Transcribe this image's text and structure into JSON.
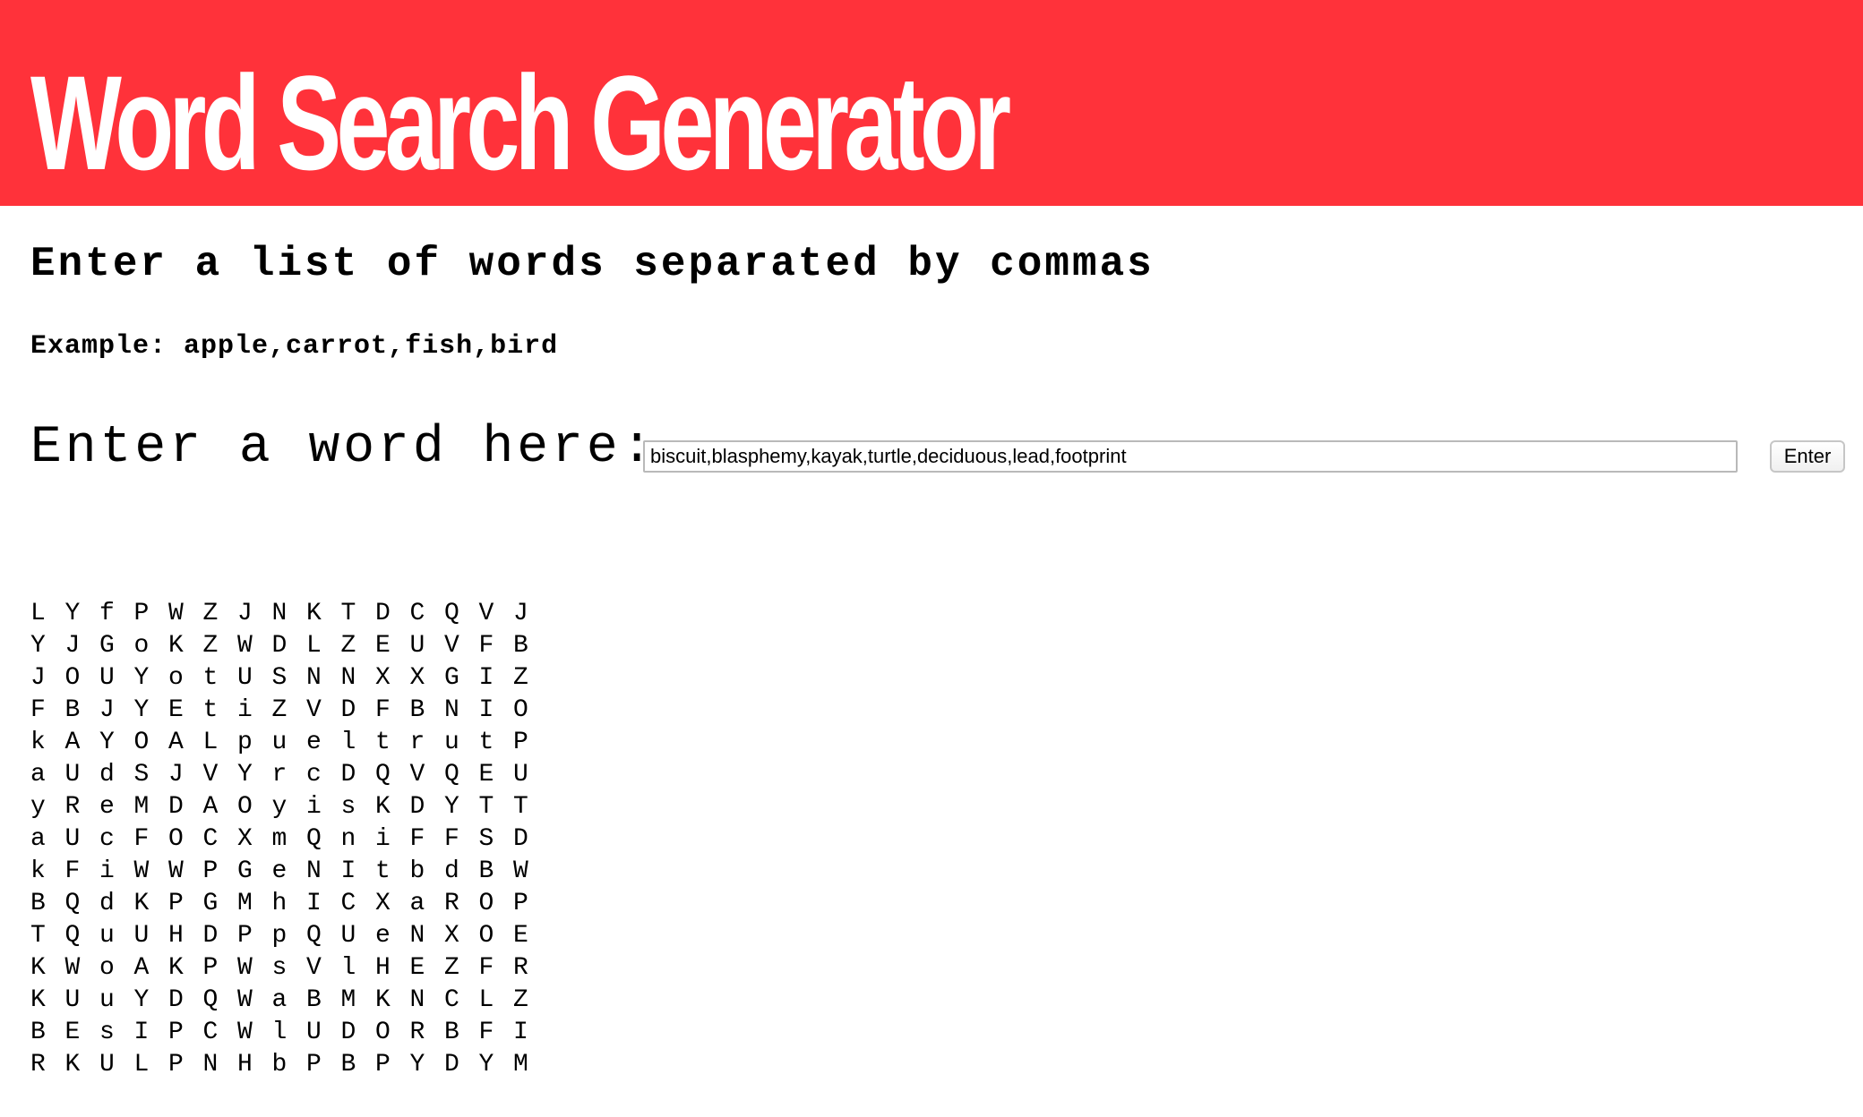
{
  "header": {
    "title": "Word Search Generator",
    "background_color": "#ff323a"
  },
  "instructions": {
    "heading": "Enter a list of words separated by commas",
    "example": "Example: apple,carrot,fish,bird"
  },
  "form": {
    "label": "Enter a word here:",
    "input_value": "biscuit,blasphemy,kayak,turtle,deciduous,lead,footprint",
    "button_label": "Enter"
  },
  "grid": [
    [
      "L",
      "Y",
      "f",
      "P",
      "W",
      "Z",
      "J",
      "N",
      "K",
      "T",
      "D",
      "C",
      "Q",
      "V",
      "J"
    ],
    [
      "Y",
      "J",
      "G",
      "o",
      "K",
      "Z",
      "W",
      "D",
      "L",
      "Z",
      "E",
      "U",
      "V",
      "F",
      "B"
    ],
    [
      "J",
      "O",
      "U",
      "Y",
      "o",
      "t",
      "U",
      "S",
      "N",
      "N",
      "X",
      "X",
      "G",
      "I",
      "Z"
    ],
    [
      "F",
      "B",
      "J",
      "Y",
      "E",
      "t",
      "i",
      "Z",
      "V",
      "D",
      "F",
      "B",
      "N",
      "I",
      "O"
    ],
    [
      "k",
      "A",
      "Y",
      "O",
      "A",
      "L",
      "p",
      "u",
      "e",
      "l",
      "t",
      "r",
      "u",
      "t",
      "P"
    ],
    [
      "a",
      "U",
      "d",
      "S",
      "J",
      "V",
      "Y",
      "r",
      "c",
      "D",
      "Q",
      "V",
      "Q",
      "E",
      "U"
    ],
    [
      "y",
      "R",
      "e",
      "M",
      "D",
      "A",
      "O",
      "y",
      "i",
      "s",
      "K",
      "D",
      "Y",
      "T",
      "T"
    ],
    [
      "a",
      "U",
      "c",
      "F",
      "O",
      "C",
      "X",
      "m",
      "Q",
      "n",
      "i",
      "F",
      "F",
      "S",
      "D"
    ],
    [
      "k",
      "F",
      "i",
      "W",
      "W",
      "P",
      "G",
      "e",
      "N",
      "I",
      "t",
      "b",
      "d",
      "B",
      "W"
    ],
    [
      "B",
      "Q",
      "d",
      "K",
      "P",
      "G",
      "M",
      "h",
      "I",
      "C",
      "X",
      "a",
      "R",
      "O",
      "P"
    ],
    [
      "T",
      "Q",
      "u",
      "U",
      "H",
      "D",
      "P",
      "p",
      "Q",
      "U",
      "e",
      "N",
      "X",
      "O",
      "E"
    ],
    [
      "K",
      "W",
      "o",
      "A",
      "K",
      "P",
      "W",
      "s",
      "V",
      "l",
      "H",
      "E",
      "Z",
      "F",
      "R"
    ],
    [
      "K",
      "U",
      "u",
      "Y",
      "D",
      "Q",
      "W",
      "a",
      "B",
      "M",
      "K",
      "N",
      "C",
      "L",
      "Z"
    ],
    [
      "B",
      "E",
      "s",
      "I",
      "P",
      "C",
      "W",
      "l",
      "U",
      "D",
      "O",
      "R",
      "B",
      "F",
      "I"
    ],
    [
      "R",
      "K",
      "U",
      "L",
      "P",
      "N",
      "H",
      "b",
      "P",
      "B",
      "P",
      "Y",
      "D",
      "Y",
      "M"
    ]
  ]
}
